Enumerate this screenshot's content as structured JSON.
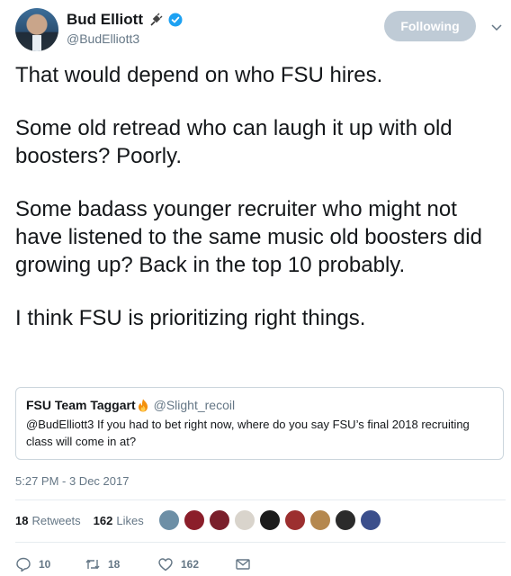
{
  "author": {
    "display_name": "Bud Elliott",
    "handle": "@BudElliott3",
    "emoji_icon": "electric-plug-icon",
    "verified_icon": "verified-badge-icon"
  },
  "follow_button": {
    "label": "Following"
  },
  "tweet": {
    "paragraphs": [
      "That would depend on who FSU hires.",
      "Some old retread who can laugh it up with old boosters? Poorly.",
      "Some badass younger recruiter who might not have listened to the same music old boosters did growing up? Back in the top 10 probably.",
      "I think FSU is prioritizing right things."
    ]
  },
  "quoted_tweet": {
    "display_name": "FSU Team Taggart",
    "emoji_icon": "fire-icon",
    "handle": "@Slight_recoil",
    "text": "@BudElliott3 If you had to bet right now, where do you say FSU’s final 2018 recruiting class will come in at?"
  },
  "timestamp": "5:27 PM - 3 Dec 2017",
  "stats": {
    "retweets_count": "18",
    "retweets_label": "Retweets",
    "likes_count": "162",
    "likes_label": "Likes"
  },
  "likers": [
    {
      "color": "#6d8fa6"
    },
    {
      "color": "#8b1e2a"
    },
    {
      "color": "#7a1f2b"
    },
    {
      "color": "#d9d4cc"
    },
    {
      "color": "#1c1c1c"
    },
    {
      "color": "#9c2f2f"
    },
    {
      "color": "#b5884f"
    },
    {
      "color": "#2b2b2b"
    },
    {
      "color": "#3b4f8c"
    }
  ],
  "actions": {
    "reply_count": "10",
    "retweet_count": "18",
    "like_count": "162"
  },
  "colors": {
    "text": "#14171a",
    "secondary": "#657786",
    "verified": "#1da1f2",
    "following_button": "#bfcbd6",
    "border": "#ccd6dd"
  }
}
